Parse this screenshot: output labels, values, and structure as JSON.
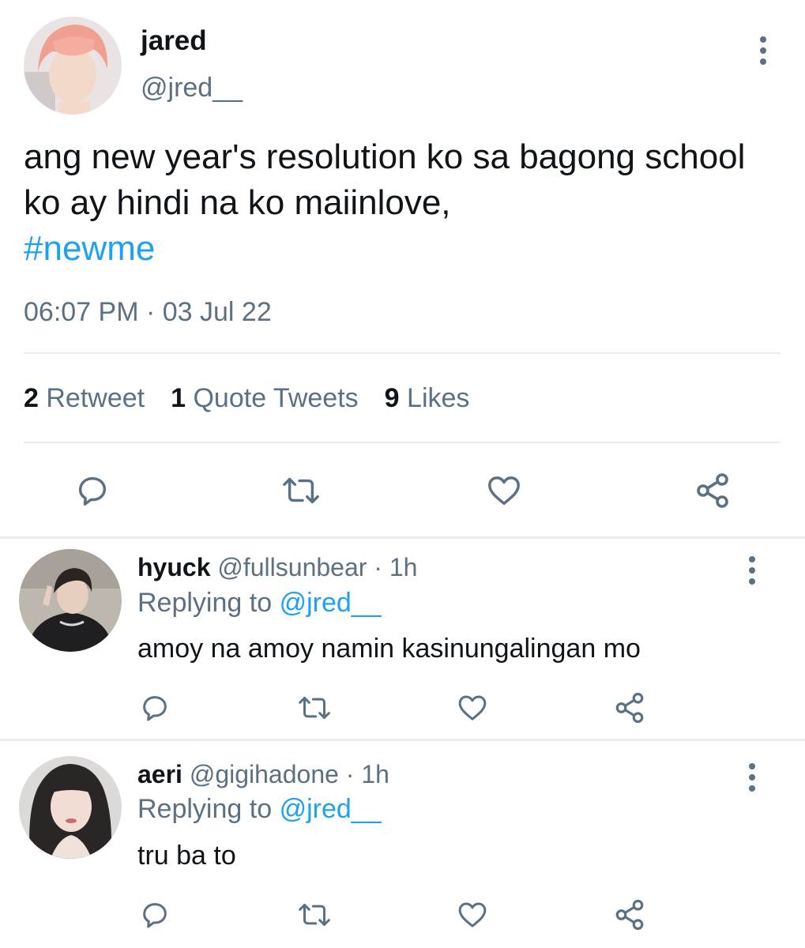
{
  "tweet": {
    "name": "jared",
    "handle": "@jred__",
    "text": "ang new year's resolution ko sa bagong school ko ay hindi na ko maiinlove,",
    "hashtag": "#newme",
    "timestamp": "06:07 PM · 03 Jul 22",
    "stats": {
      "retweets_count": "2",
      "retweets_label": "Retweet",
      "quotes_count": "1",
      "quotes_label": "Quote Tweets",
      "likes_count": "9",
      "likes_label": "Likes"
    }
  },
  "replies": [
    {
      "name": "hyuck",
      "handle": "@fullsunbear",
      "time": "· 1h",
      "replying_prefix": "Replying to",
      "replying_handle": "@jred__",
      "text": "amoy na amoy namin kasinungalingan mo"
    },
    {
      "name": "aeri",
      "handle": "@gigihadone",
      "time": "· 1h",
      "replying_prefix": "Replying to",
      "replying_handle": "@jred__",
      "text": "tru ba to"
    }
  ],
  "icons": {
    "more": "more-vertical-icon",
    "reply": "reply-bubble-icon",
    "retweet": "retweet-icon",
    "like": "heart-icon",
    "share": "share-icon"
  },
  "colors": {
    "text": "#0f1419",
    "secondary": "#5b7083",
    "link": "#1da1f2",
    "divider": "#e6ecf0"
  }
}
